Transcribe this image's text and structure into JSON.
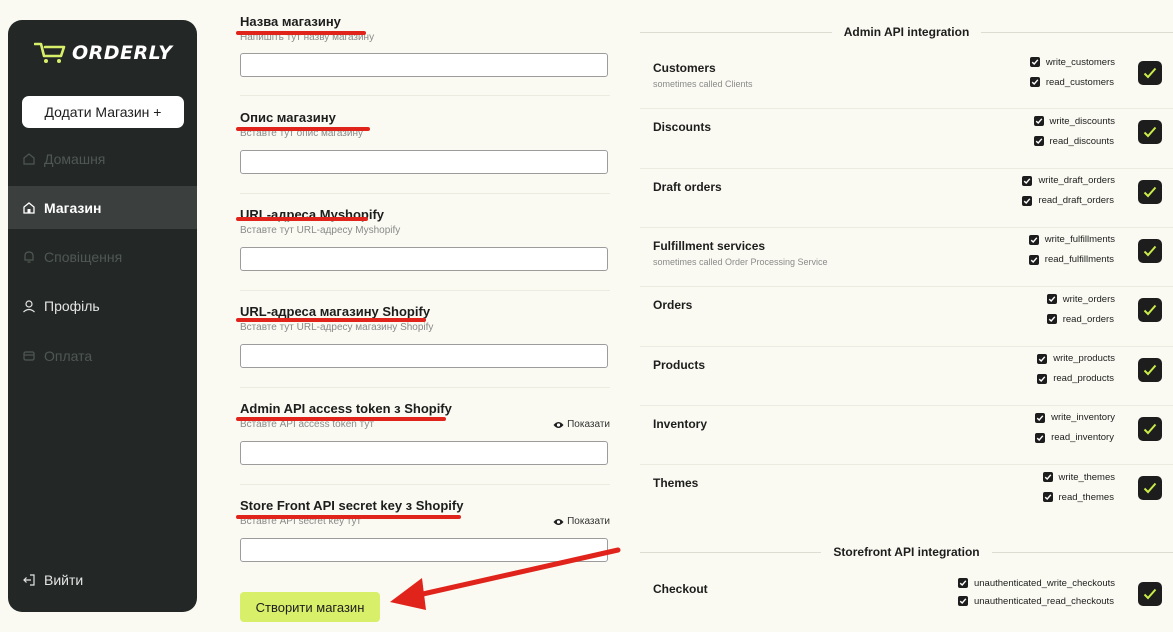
{
  "sidebar": {
    "logo": "ORDERLY",
    "add_store": "Додати Магазин +",
    "items": [
      {
        "label": "Домашня",
        "icon": "home-icon"
      },
      {
        "label": "Магазин",
        "icon": "store-icon"
      },
      {
        "label": "Сповіщення",
        "icon": "bell-icon"
      },
      {
        "label": "Профіль",
        "icon": "user-icon"
      },
      {
        "label": "Оплата",
        "icon": "card-icon"
      }
    ],
    "logout": "Вийти"
  },
  "form": {
    "fields": [
      {
        "title": "Назва магазину",
        "hint": "Напишіть тут назву магазину",
        "value": ""
      },
      {
        "title": "Опис магазину",
        "hint": "Вставте тут опис магазину",
        "value": ""
      },
      {
        "title": "URL-адреса Myshopify",
        "hint": "Вставте тут URL-адресу Myshopify",
        "value": ""
      },
      {
        "title": "URL-адреса магазину Shopify",
        "hint": "Вставте тут URL-адресу магазину Shopify",
        "value": ""
      },
      {
        "title": "Admin API access token з Shopify",
        "hint": "Вставте API access token тут",
        "value": "",
        "toggle": "Показати"
      },
      {
        "title": "Store Front API secret key з Shopify",
        "hint": "Вставте API secret key тут",
        "value": "",
        "toggle": "Показати"
      }
    ],
    "submit": "Створити магазин"
  },
  "admin": {
    "title": "Admin API integration",
    "rows": [
      {
        "name": "Customers",
        "sub": "sometimes called Clients",
        "scopes": [
          "write_customers",
          "read_customers"
        ]
      },
      {
        "name": "Discounts",
        "sub": "",
        "scopes": [
          "write_discounts",
          "read_discounts"
        ]
      },
      {
        "name": "Draft orders",
        "sub": "",
        "scopes": [
          "write_draft_orders",
          "read_draft_orders"
        ]
      },
      {
        "name": "Fulfillment services",
        "sub": "sometimes called Order Processing Service",
        "scopes": [
          "write_fulfillments",
          "read_fulfillments"
        ]
      },
      {
        "name": "Orders",
        "sub": "",
        "scopes": [
          "write_orders",
          "read_orders"
        ]
      },
      {
        "name": "Products",
        "sub": "",
        "scopes": [
          "write_products",
          "read_products"
        ]
      },
      {
        "name": "Inventory",
        "sub": "",
        "scopes": [
          "write_inventory",
          "read_inventory"
        ]
      },
      {
        "name": "Themes",
        "sub": "",
        "scopes": [
          "write_themes",
          "read_themes"
        ]
      }
    ]
  },
  "storefront": {
    "title": "Storefront API integration",
    "rows": [
      {
        "name": "Checkout",
        "sub": "",
        "scopes": [
          "unauthenticated_write_checkouts",
          "unauthenticated_read_checkouts"
        ]
      }
    ]
  },
  "colors": {
    "sidebar": "#232826",
    "accent": "#d8ef6a",
    "annotation": "#e0241c",
    "check": "#c9ec4a"
  }
}
